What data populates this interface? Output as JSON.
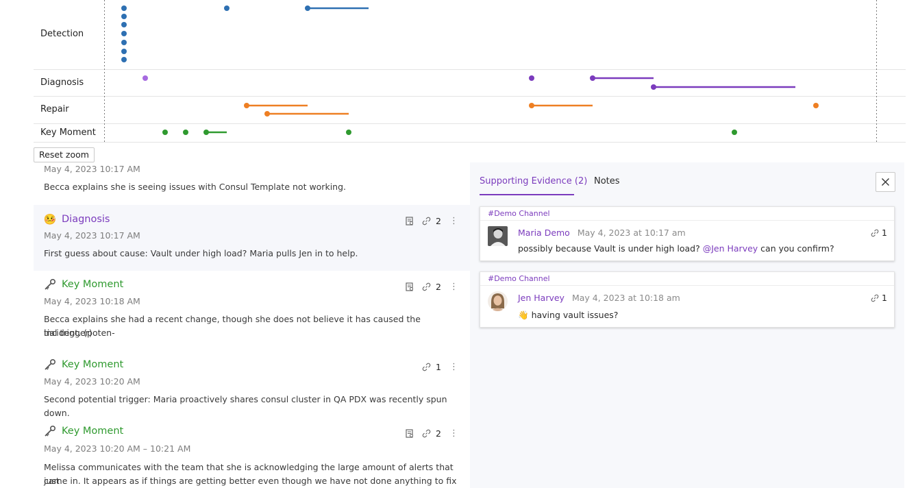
{
  "timeline": {
    "lanes": [
      {
        "id": "detection",
        "label": "Detection"
      },
      {
        "id": "diagnosis",
        "label": "Diagnosis"
      },
      {
        "id": "repair",
        "label": "Repair"
      },
      {
        "id": "key-moment",
        "label": "Key Moment"
      }
    ],
    "colors": {
      "detection": "#2e70b2",
      "diagnosis": "#7b3bbd",
      "diagnosis_light": "#a66ae0",
      "repair": "#ee7f23",
      "key-moment": "#2f9a2f"
    },
    "reset_zoom_label": "Reset zoom"
  },
  "events": [
    {
      "type": "",
      "timestamp": "May 4, 2023 10:17 AM",
      "description": "Becca explains she is seeing issues with Consul Template not working."
    },
    {
      "type": "Diagnosis",
      "emoji": "🤒",
      "timestamp": "May 4, 2023 10:17 AM",
      "description": "First guess about cause: Vault under high load? Maria pulls Jen in to help.",
      "link_count": "2",
      "has_evidence": true
    },
    {
      "type": "Key Moment",
      "emoji": "key-icon",
      "timestamp": "May 4, 2023 10:18 AM",
      "description_line1": "Becca explains she had a recent change, though she does not believe it has caused the incident. (poten-",
      "description_line2": "tial trigger)",
      "link_count": "2",
      "has_evidence": true
    },
    {
      "type": "Key Moment",
      "emoji": "key-icon",
      "timestamp": "May 4, 2023 10:20 AM",
      "description": "Second potential trigger: Maria proactively shares consul cluster in QA PDX was recently spun down.",
      "link_count": "1",
      "has_evidence": false
    },
    {
      "type": "Key Moment",
      "emoji": "key-icon",
      "timestamp": "May 4, 2023 10:20 AM – 10:21 AM",
      "description_line1": "Melissa communicates with the team that she is acknowledging the large amount of alerts that just",
      "description_line2": "came in. It appears as if things are getting better even though we have not done anything to fix it.",
      "link_count": "2",
      "has_evidence": true
    }
  ],
  "panel": {
    "tabs": [
      {
        "label": "Supporting Evidence (2)",
        "active": true
      },
      {
        "label": "Notes",
        "active": false
      }
    ],
    "close_label": "X",
    "messages": [
      {
        "channel": "#Demo Channel",
        "author": "Maria Demo",
        "time": "May 4, 2023 at 10:17 am",
        "text_before": "possibly because Vault is under high load? ",
        "mention": "@Jen Harvey",
        "text_after": " can you confirm?",
        "link_count": "1"
      },
      {
        "channel": "#Demo Channel",
        "author": "Jen Harvey",
        "time": "May 4, 2023 at 10:18 am",
        "emoji": "👋",
        "text": "having vault issues?",
        "link_count": "1"
      }
    ]
  }
}
